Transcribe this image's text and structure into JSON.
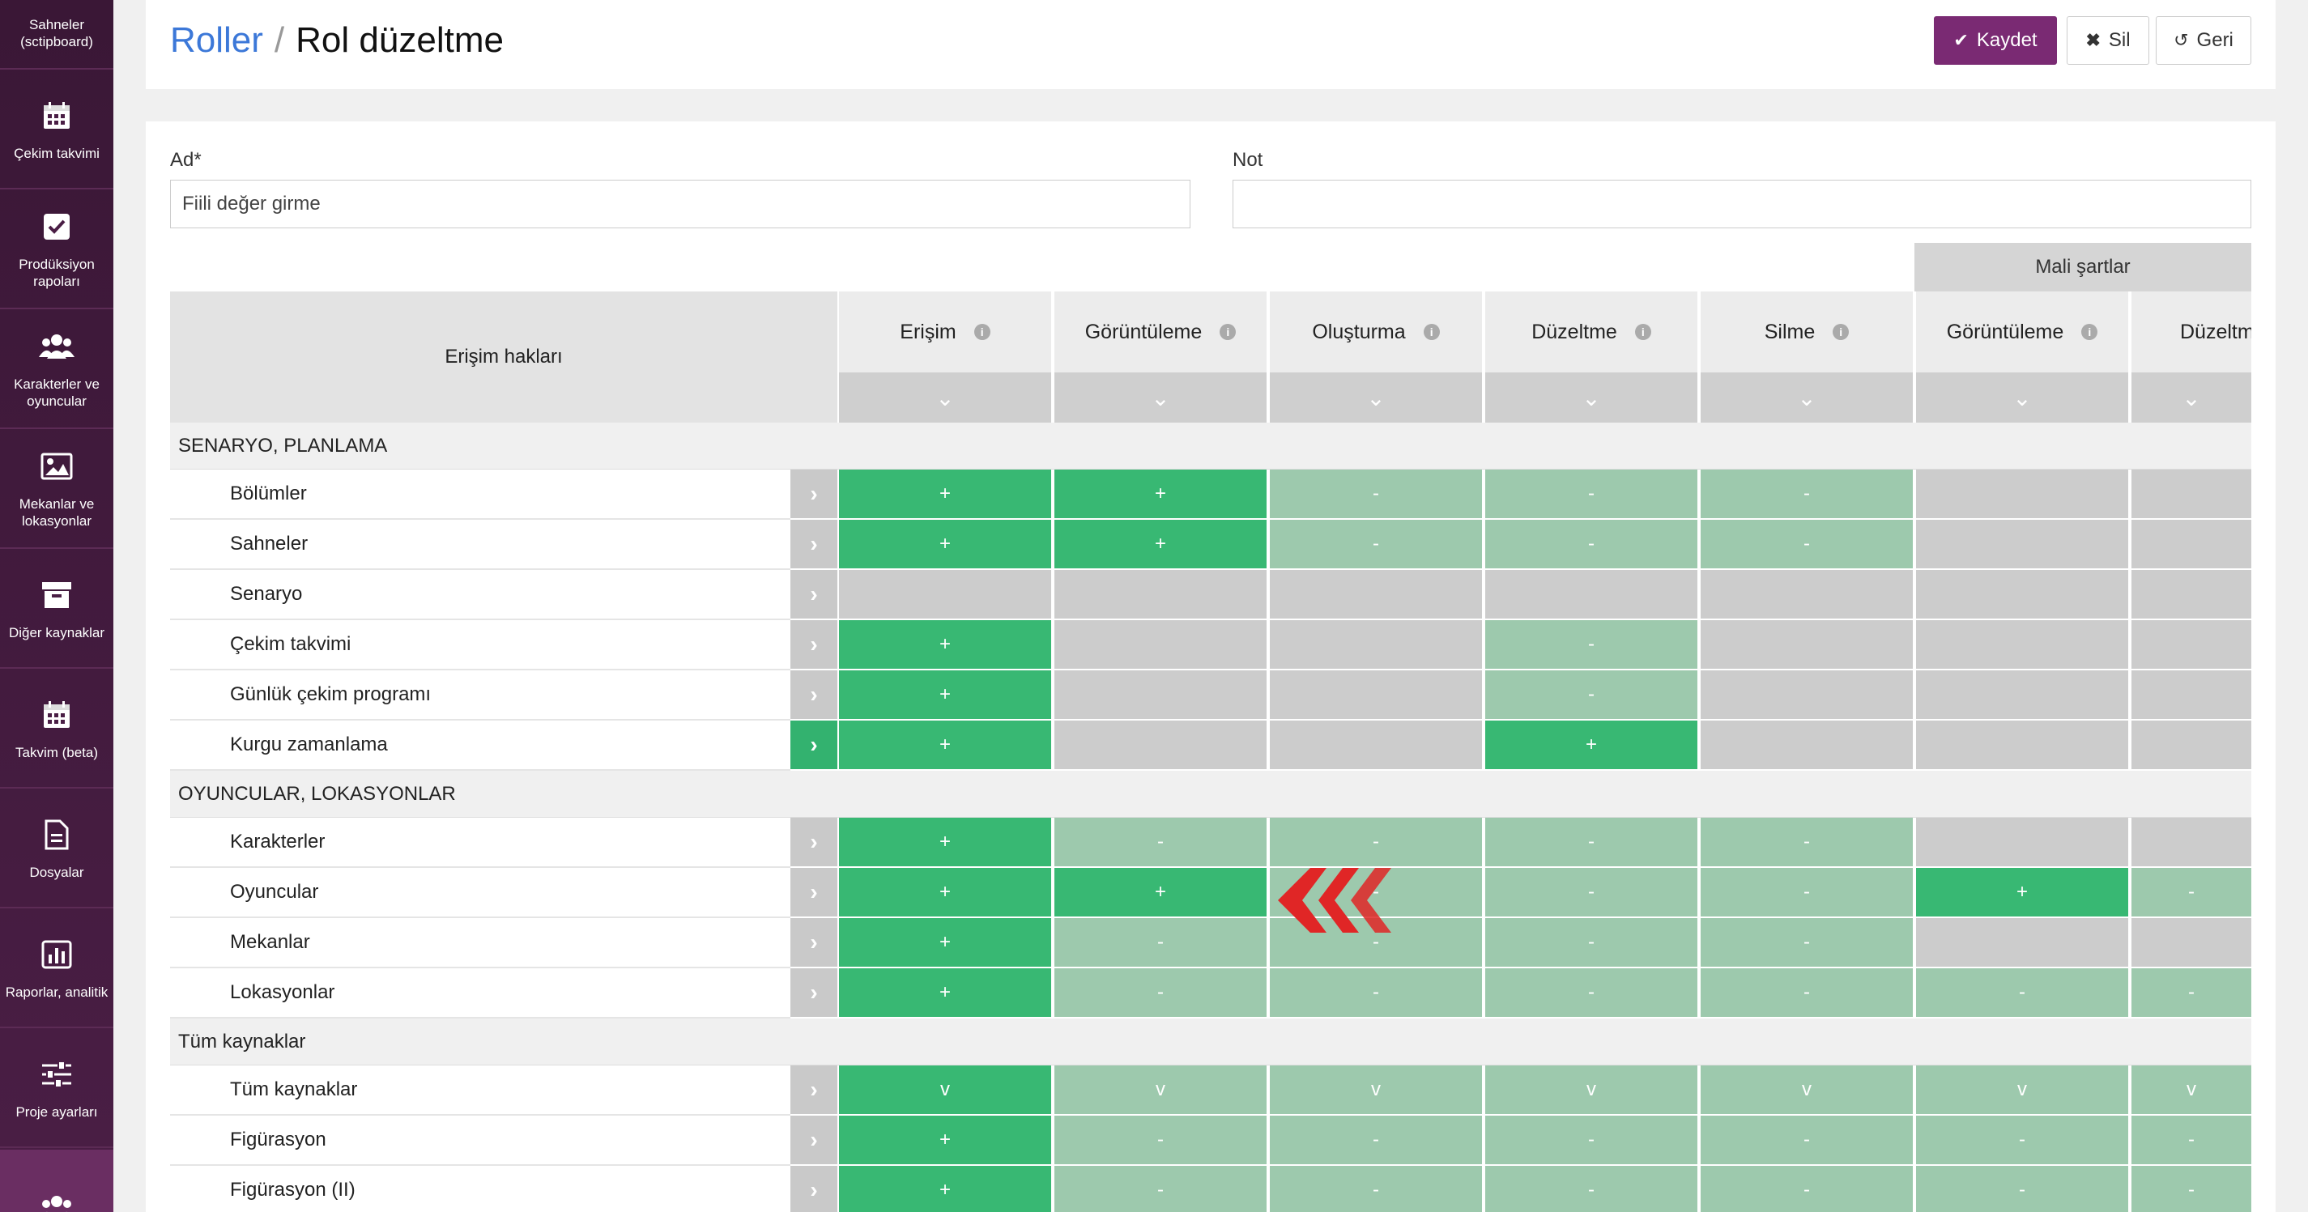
{
  "sidebar": {
    "items": [
      {
        "label": "Sahneler (sctipboard)",
        "icon": "scene-icon"
      },
      {
        "label": "Çekim takvimi",
        "icon": "calendar-icon"
      },
      {
        "label": "Prodüksiyon rapoları",
        "icon": "checkbox-icon"
      },
      {
        "label": "Karakterler ve oyuncular",
        "icon": "users-icon"
      },
      {
        "label": "Mekanlar ve lokasyonlar",
        "icon": "image-icon"
      },
      {
        "label": "Diğer kaynaklar",
        "icon": "archive-icon"
      },
      {
        "label": "Takvim (beta)",
        "icon": "calendar-icon"
      },
      {
        "label": "Dosyalar",
        "icon": "file-icon"
      },
      {
        "label": "Raporlar, analitik",
        "icon": "bar-chart-icon"
      },
      {
        "label": "Proje ayarları",
        "icon": "sliders-icon"
      },
      {
        "label": "",
        "icon": "users-icon"
      }
    ]
  },
  "header": {
    "breadcrumb": "Roller",
    "separator": "/",
    "title": "Rol düzeltme",
    "save_label": "Kaydet",
    "delete_label": "Sil",
    "back_label": "Geri"
  },
  "form": {
    "name_label": "Ad",
    "name_required": "*",
    "name_value": "Fiili değer girme",
    "note_label": "Not",
    "note_value": ""
  },
  "table": {
    "group_header": "Mali şartlar",
    "rights_header": "Erişim hakları",
    "columns": [
      "Erişim",
      "Görüntüleme",
      "Oluşturma",
      "Düzeltme",
      "Silme",
      "Görüntüleme",
      "Düzeltme"
    ],
    "sections": [
      {
        "title": "SENARYO, PLANLAMA",
        "rows": [
          {
            "name": "Bölümler",
            "cells": [
              "+",
              "+",
              "-",
              "-",
              "-",
              "",
              ""
            ]
          },
          {
            "name": "Sahneler",
            "cells": [
              "+",
              "+",
              "-",
              "-",
              "-",
              "",
              ""
            ]
          },
          {
            "name": "Senaryo",
            "cells": [
              "",
              "",
              "",
              "",
              "",
              "",
              ""
            ]
          },
          {
            "name": "Çekim takvimi",
            "cells": [
              "+",
              "",
              "",
              "-",
              "",
              "",
              ""
            ]
          },
          {
            "name": "Günlük çekim programı",
            "cells": [
              "+",
              "",
              "",
              "-",
              "",
              "",
              ""
            ]
          },
          {
            "name": "Kurgu zamanlama",
            "cells": [
              "+",
              "",
              "",
              "+",
              "",
              "",
              ""
            ]
          }
        ]
      },
      {
        "title": "OYUNCULAR, LOKASYONLAR",
        "rows": [
          {
            "name": "Karakterler",
            "cells": [
              "+",
              "-",
              "-",
              "-",
              "-",
              "",
              ""
            ]
          },
          {
            "name": "Oyuncular",
            "cells": [
              "+",
              "+",
              "-",
              "-",
              "-",
              "+",
              "-"
            ]
          },
          {
            "name": "Mekanlar",
            "cells": [
              "+",
              "-",
              "-",
              "-",
              "-",
              "",
              ""
            ]
          },
          {
            "name": "Lokasyonlar",
            "cells": [
              "+",
              "-",
              "-",
              "-",
              "-",
              "-",
              "-"
            ]
          }
        ]
      },
      {
        "title": "Tüm kaynaklar",
        "rows": [
          {
            "name": "Tüm kaynaklar",
            "cells": [
              "v",
              "v",
              "v",
              "v",
              "v",
              "v",
              "v"
            ]
          },
          {
            "name": "Figürasyon",
            "cells": [
              "+",
              "-",
              "-",
              "-",
              "-",
              "-",
              "-"
            ]
          },
          {
            "name": "Figürasyon (II)",
            "cells": [
              "+",
              "-",
              "-",
              "-",
              "-",
              "-",
              "-"
            ]
          }
        ]
      }
    ]
  },
  "colors": {
    "sidebar_bg": "#3a1736",
    "primary": "#7a2a73",
    "link": "#3c78d8",
    "full_access": "#38b873",
    "partial_access": "#9dc9ad",
    "no_access": "#cccccc",
    "pointer": "#e02626"
  }
}
